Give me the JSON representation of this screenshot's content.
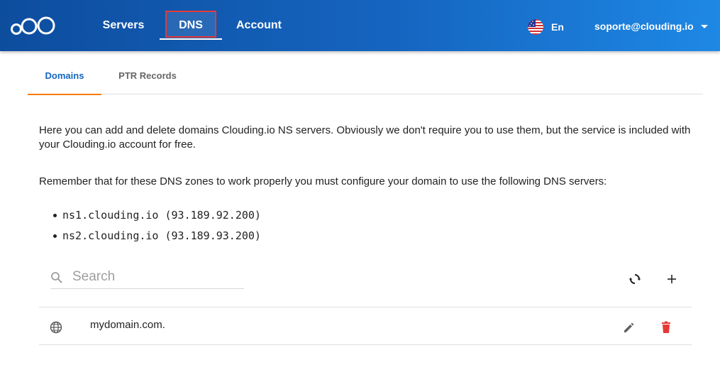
{
  "header": {
    "nav": {
      "servers": "Servers",
      "dns": "DNS",
      "account": "Account"
    },
    "language": "En",
    "user_email": "soporte@clouding.io"
  },
  "tabs": {
    "domains": "Domains",
    "ptr_records": "PTR Records"
  },
  "intro": {
    "paragraph1": "Here you can add and delete domains Clouding.io NS servers. Obviously we don't require you to use them, but the service is included with your Clouding.io account for free.",
    "paragraph2": "Remember that for these DNS zones to work properly you must configure your domain to use the following DNS servers:",
    "ns_servers": [
      "ns1.clouding.io (93.189.92.200)",
      "ns2.clouding.io (93.189.93.200)"
    ]
  },
  "search": {
    "placeholder": "Search",
    "value": ""
  },
  "domains": [
    {
      "name": "mydomain.com."
    }
  ],
  "icons": {
    "search": "search-icon",
    "refresh": "refresh-icon",
    "add": "plus-icon",
    "globe": "globe-icon",
    "edit": "pencil-icon",
    "delete": "trash-icon",
    "flag": "us-flag-icon",
    "caret": "caret-down-icon"
  },
  "colors": {
    "header_start": "#0d4d9e",
    "header_end": "#1e88e5",
    "active_tab_text": "#1565c0",
    "active_tab_indicator": "#f57c00",
    "highlight_box": "#e53935",
    "delete": "#e53935"
  }
}
